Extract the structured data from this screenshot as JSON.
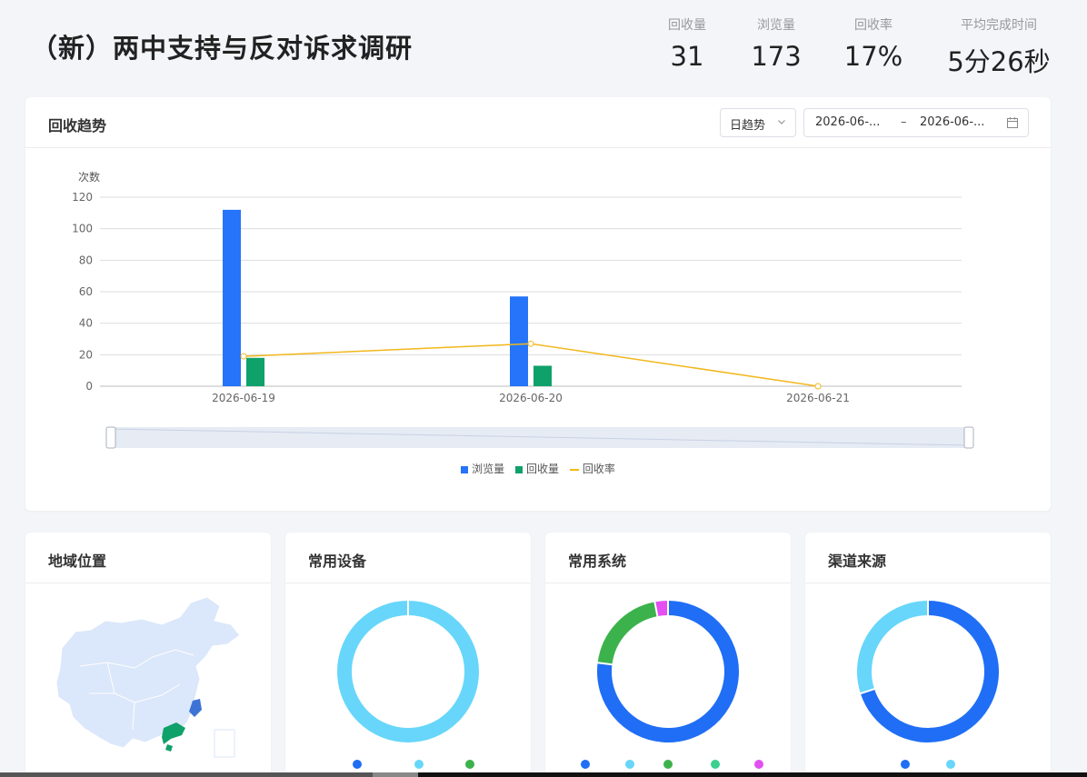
{
  "header": {
    "title": "（新）两中支持与反对诉求调研",
    "stats": [
      {
        "label": "回收量",
        "value": "31"
      },
      {
        "label": "浏览量",
        "value": "173"
      },
      {
        "label": "回收率",
        "value": "17%"
      },
      {
        "label": "平均完成时间",
        "value": "5分26秒"
      }
    ]
  },
  "trend": {
    "title": "回收趋势",
    "granularity": "日趋势",
    "date_start": "2026-06-...",
    "date_sep": "–",
    "date_end": "2026-06-..."
  },
  "chart_data": {
    "type": "bar",
    "categories": [
      "2026-06-19",
      "2026-06-20",
      "2026-06-21"
    ],
    "series": [
      {
        "name": "浏览量",
        "type": "bar",
        "values": [
          112,
          57,
          0
        ],
        "color": "#2574f9"
      },
      {
        "name": "回收量",
        "type": "bar",
        "values": [
          18,
          13,
          0
        ],
        "color": "#0fa16a"
      },
      {
        "name": "回收率",
        "type": "line",
        "values": [
          19,
          27,
          0
        ],
        "color": "#f2b71c"
      }
    ],
    "ylabel": "次数",
    "ylim": [
      0,
      120
    ],
    "yticks": [
      "0",
      "20",
      "40",
      "60",
      "80",
      "100",
      "120"
    ],
    "grid": true,
    "legend_position": "bottom"
  },
  "panels": {
    "region": {
      "title": "地域位置",
      "highlight_colors": [
        "#3e73d6",
        "#0fa16a"
      ],
      "base_color": "#dbe7fa"
    },
    "device": {
      "title": "常用设备",
      "dot_colors": [
        "#1f6ef5",
        "#67d6fa",
        "#3cb24c"
      ]
    },
    "os": {
      "title": "常用系统",
      "dot_colors": [
        "#1f6ef5",
        "#67d6fa",
        "#3cb24c",
        "#39d090",
        "#e34ff0"
      ]
    },
    "channel": {
      "title": "渠道来源",
      "dot_colors": [
        "#1f6ef5",
        "#67d6fa"
      ]
    }
  },
  "donut_data": [
    {
      "type": "pie",
      "colors": [
        "#67d6fa"
      ],
      "values": [
        100
      ]
    },
    {
      "type": "pie",
      "colors": [
        "#1f6ef5",
        "#3cb24c",
        "#e34ff0"
      ],
      "values": [
        77,
        20,
        3
      ]
    },
    {
      "type": "pie",
      "colors": [
        "#1f6ef5",
        "#67d6fa"
      ],
      "values": [
        70,
        30
      ]
    }
  ]
}
